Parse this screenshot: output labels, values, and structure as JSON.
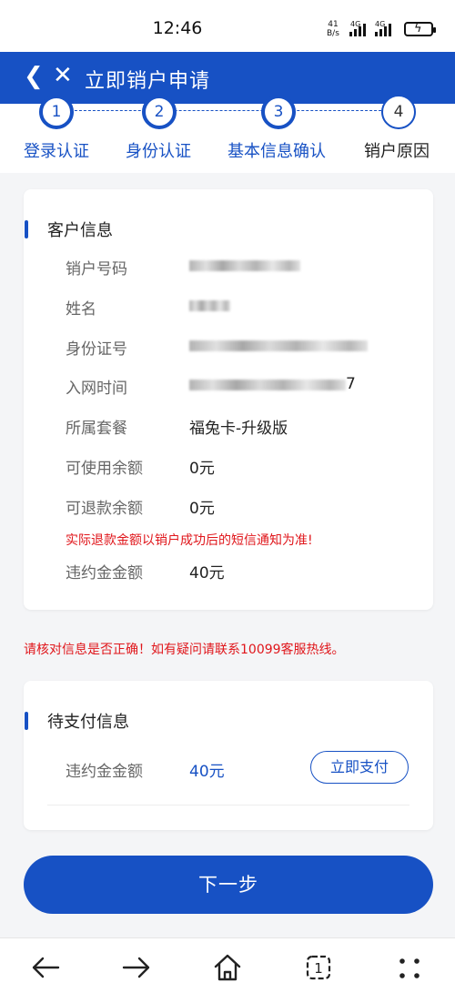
{
  "status": {
    "time": "12:46",
    "net_rate_value": "41",
    "net_rate_unit": "B/s",
    "sim1": "4G",
    "sim2": "4G"
  },
  "header": {
    "title": "立即销户申请"
  },
  "steps": [
    {
      "number": "1",
      "label": "登录认证"
    },
    {
      "number": "2",
      "label": "身份认证"
    },
    {
      "number": "3",
      "label": "基本信息确认"
    },
    {
      "number": "4",
      "label": "销户原因"
    }
  ],
  "customer_info": {
    "title": "客户信息",
    "rows": [
      {
        "label": "销户号码",
        "value": ""
      },
      {
        "label": "姓名",
        "value": ""
      },
      {
        "label": "身份证号",
        "value": ""
      },
      {
        "label": "入网时间",
        "value": "7"
      },
      {
        "label": "所属套餐",
        "value": "福兔卡-升级版"
      },
      {
        "label": "可使用余额",
        "value": "0元"
      },
      {
        "label": "可退款余额",
        "value": "0元"
      },
      {
        "label": "违约金金额",
        "value": "40元"
      }
    ],
    "refund_notice": "实际退款金额以销户成功后的短信通知为准!"
  },
  "verify_notice": "请核对信息是否正确！如有疑问请联系10099客服热线。",
  "payment": {
    "title": "待支付信息",
    "label": "违约金金额",
    "amount": "40元",
    "pay_button": "立即支付"
  },
  "next_button": "下一步",
  "colors": {
    "primary": "#1751c4",
    "warning": "#e0161b"
  }
}
